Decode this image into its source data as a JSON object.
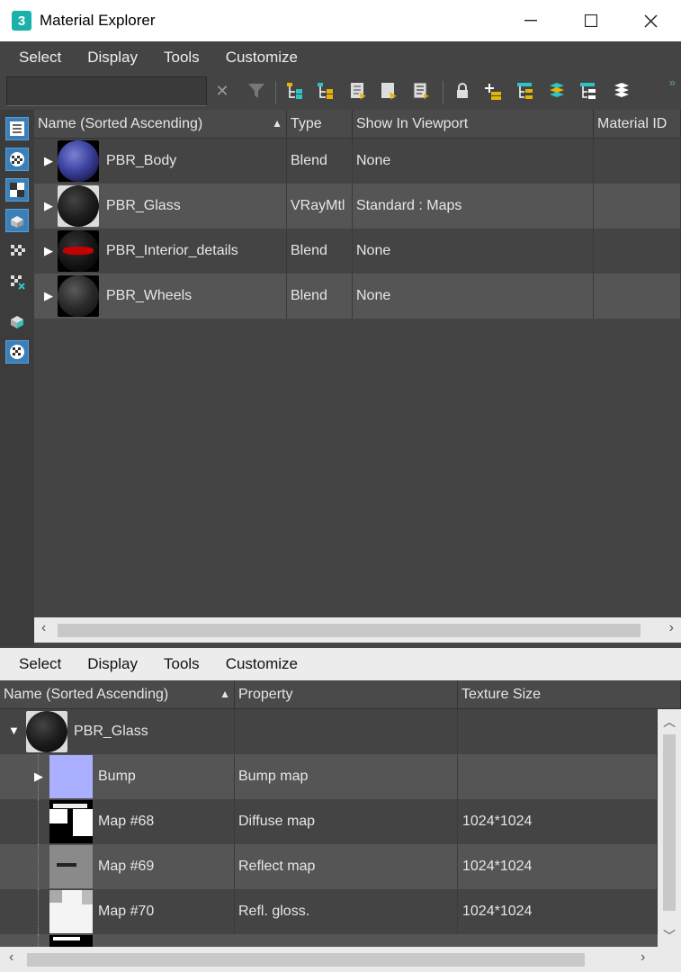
{
  "window": {
    "app_icon": "3",
    "title": "Material Explorer",
    "controls": {
      "minimize": "—",
      "maximize": "☐",
      "close": "✕"
    }
  },
  "top_menu": [
    "Select",
    "Display",
    "Tools",
    "Customize"
  ],
  "bottom_menu": [
    "Select",
    "Display",
    "Tools",
    "Customize"
  ],
  "search": {
    "value": "",
    "placeholder": ""
  },
  "top_table": {
    "columns": [
      "Name (Sorted Ascending)",
      "Type",
      "Show In Viewport",
      "Material ID"
    ],
    "rows": [
      {
        "name": "PBR_Body",
        "type": "Blend",
        "show": "None",
        "thumb_color": "#4a4fa8"
      },
      {
        "name": "PBR_Glass",
        "type": "VRayMtl",
        "show": "Standard : Maps",
        "thumb_color": "#202020"
      },
      {
        "name": "PBR_Interior_details",
        "type": "Blend",
        "show": "None",
        "thumb_color": "#8b0000"
      },
      {
        "name": "PBR_Wheels",
        "type": "Blend",
        "show": "None",
        "thumb_color": "#2b2b2b"
      }
    ]
  },
  "bottom_table": {
    "columns": [
      "Name (Sorted Ascending)",
      "Property",
      "Texture Size"
    ],
    "parent": {
      "name": "PBR_Glass"
    },
    "rows": [
      {
        "name": "Bump",
        "property": "Bump map",
        "size": "",
        "thumb": "bump"
      },
      {
        "name": "Map #68",
        "property": "Diffuse map",
        "size": "1024*1024",
        "thumb": "mask1"
      },
      {
        "name": "Map #69",
        "property": "Reflect map",
        "size": "1024*1024",
        "thumb": "gray"
      },
      {
        "name": "Map #70",
        "property": "Refl. gloss.",
        "size": "1024*1024",
        "thumb": "white"
      }
    ]
  },
  "colors": {
    "accent": "#3b7fb8",
    "icon_teal": "#1ab1a9",
    "icon_yellow": "#e8b400"
  }
}
